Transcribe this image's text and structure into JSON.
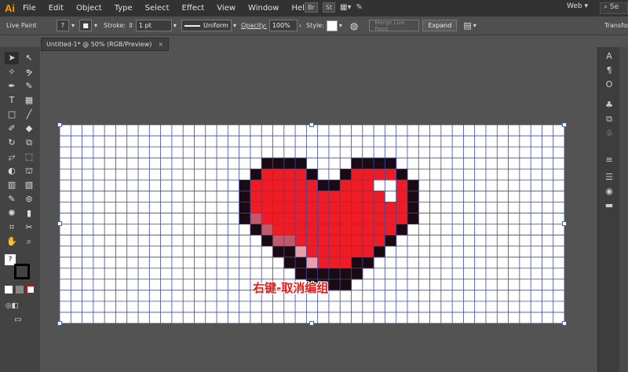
{
  "app": {
    "logo": "Ai",
    "menu": [
      "File",
      "Edit",
      "Object",
      "Type",
      "Select",
      "Effect",
      "View",
      "Window",
      "Help"
    ],
    "bridge_buttons": [
      "Br",
      "St"
    ],
    "workspace": "Web",
    "search_placeholder": "Se"
  },
  "control_bar": {
    "mode_label": "Live Paint",
    "fill_glyph": "?",
    "stroke_label": "Stroke:",
    "stroke_value": "1 pt",
    "stroke_profile": "Uniform",
    "opacity_label": "Opacity:",
    "opacity_value": "100%",
    "style_label": "Style:",
    "merge_button": "Merge Live Paint",
    "expand_button": "Expand",
    "transform_label": "Transform"
  },
  "document": {
    "tab_title": "Untitled-1* @ 50% (RGB/Preview)",
    "close_glyph": "×"
  },
  "toolbar": {
    "fill_indicator": "?"
  },
  "canvas": {
    "annotation": "右键-取消编组",
    "pixel_art": "heart",
    "grid_cols": 45,
    "grid_rows": 18
  },
  "colors": {
    "grid_line": "#3a4aa0",
    "heart_red": "#ee1c24",
    "heart_dark": "#1a0a14",
    "heart_shade": "#c05a6a",
    "heart_pink": "#e8a0a8",
    "heart_highlight": "#ffffff",
    "annotation_red": "#e21b1b"
  }
}
